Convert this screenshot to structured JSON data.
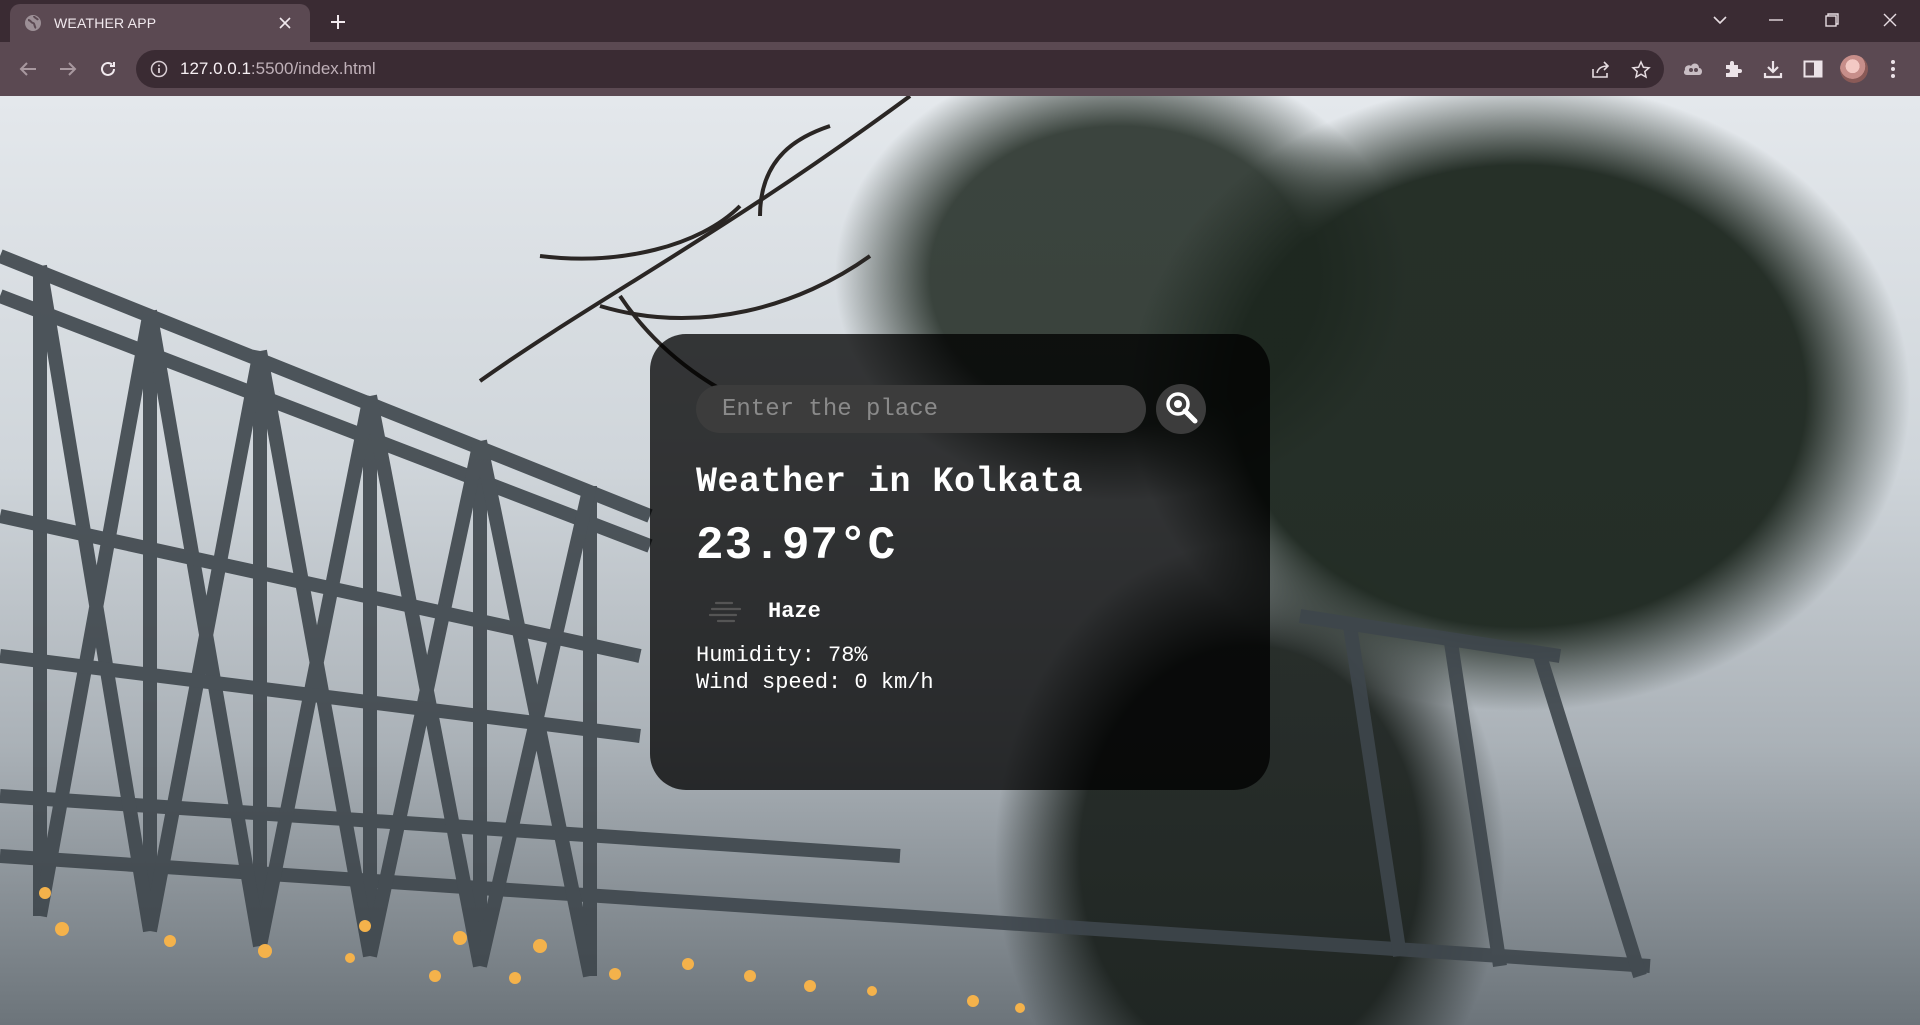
{
  "browser": {
    "tab_title": "WEATHER APP",
    "url_host": "127.0.0.1",
    "url_rest": ":5500/index.html"
  },
  "weather": {
    "search_placeholder": "Enter the place",
    "city_heading": "Weather in Kolkata",
    "temperature": "23.97°C",
    "condition": "Haze",
    "humidity": "Humidity: 78%",
    "wind": "Wind speed: 0 km/h",
    "condition_icon": "haze-icon"
  },
  "colors": {
    "chrome_dark": "#3a2b33",
    "chrome_toolbar": "#5b4952",
    "card_bg": "rgba(0,0,0,0.76)"
  }
}
